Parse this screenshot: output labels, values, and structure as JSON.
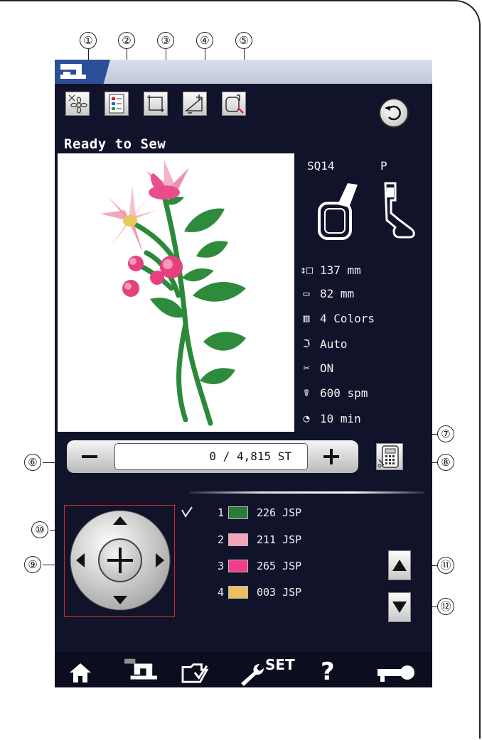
{
  "callouts": [
    "①",
    "②",
    "③",
    "④",
    "⑤",
    "⑥",
    "⑦",
    "⑧",
    "⑨",
    "⑩",
    "⑪",
    "⑫"
  ],
  "toolbar": {
    "buttons": [
      {
        "icon": "flower-jog-icon"
      },
      {
        "icon": "color-list-icon"
      },
      {
        "icon": "trace-icon"
      },
      {
        "icon": "speed-icon"
      },
      {
        "icon": "hoop-icon"
      }
    ],
    "back_icon": "back-arrow-icon"
  },
  "status": "Ready to Sew",
  "hoop_label": "SQ14",
  "foot_label": "P",
  "stats": [
    {
      "icon": "height-icon",
      "glyph": "↕□",
      "text": "137 mm"
    },
    {
      "icon": "width-icon",
      "glyph": "▭",
      "text": "82 mm"
    },
    {
      "icon": "spool-icon",
      "glyph": "▥",
      "text": "4 Colors"
    },
    {
      "icon": "tension-icon",
      "glyph": "ℑ",
      "text": "Auto"
    },
    {
      "icon": "scissors-icon",
      "glyph": "✂",
      "text": "ON"
    },
    {
      "icon": "runner-icon",
      "glyph": "☤",
      "text": "600 spm"
    },
    {
      "icon": "clock-icon",
      "glyph": "◔",
      "text": "10 min"
    }
  ],
  "stitch": {
    "counter": "0 / 4,815 ST",
    "current": 0,
    "total": 4815
  },
  "colors": [
    {
      "num": "1",
      "swatch": "#2a7a3a",
      "code": "226 JSP"
    },
    {
      "num": "2",
      "swatch": "#f3a3bb",
      "code": "211 JSP"
    },
    {
      "num": "3",
      "swatch": "#ee3e8a",
      "code": "265 JSP"
    },
    {
      "num": "4",
      "swatch": "#e9c060",
      "code": "003 JSP"
    }
  ],
  "bottom_nav": [
    {
      "icon": "home-icon"
    },
    {
      "icon": "sewing-machine-icon"
    },
    {
      "icon": "file-folder-icon"
    },
    {
      "icon": "set-wrench-icon",
      "label": "SET"
    },
    {
      "icon": "help-icon",
      "label": "?"
    },
    {
      "icon": "key-lock-icon"
    }
  ]
}
